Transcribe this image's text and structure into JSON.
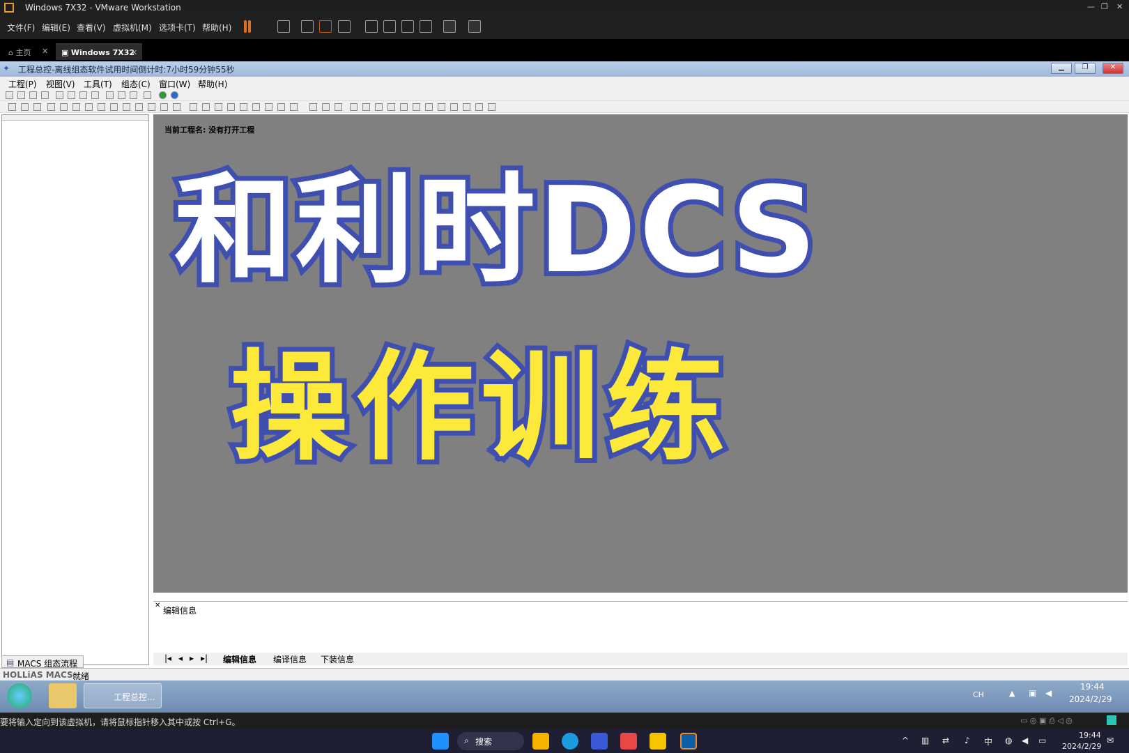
{
  "vmware": {
    "title": "Windows 7X32 - VMware Workstation",
    "menu": [
      "文件(F)",
      "编辑(E)",
      "查看(V)",
      "虚拟机(M)",
      "选项卡(T)",
      "帮助(H)"
    ],
    "tabs": [
      {
        "label": "主页"
      },
      {
        "label": "Windows 7X32"
      }
    ],
    "hint": "要将输入定向到该虚拟机，请将鼠标指针移入其中或按 Ctrl+G。"
  },
  "app": {
    "title": "工程总控-离线组态软件试用时间倒计时:7小时59分钟55秒",
    "menu": [
      "工程(P)",
      "视图(V)",
      "工具(T)",
      "组态(C)",
      "窗口(W)",
      "帮助(H)"
    ],
    "project_label": "当前工程名: 没有打开工程",
    "left_tab": "MACS 组态流程",
    "info_label": "编辑信息",
    "info_tabs": [
      "编辑信息",
      "编译信息",
      "下装信息"
    ],
    "status_brand": "HOLLiAS MACS",
    "status_text": "就绪"
  },
  "overlay": {
    "line1": "和利时DCS",
    "line2": "操作训练",
    "colors": {
      "line1": "#ffffff",
      "line2": "#fde93a",
      "outline": "#3f4fb0"
    }
  },
  "guest_taskbar": {
    "app_label": "工程总控...",
    "lang": "CH",
    "time": "19:44",
    "date": "2024/2/29"
  },
  "win11": {
    "search": "搜索",
    "ime": "中",
    "time": "19:44",
    "date": "2024/2/29"
  }
}
